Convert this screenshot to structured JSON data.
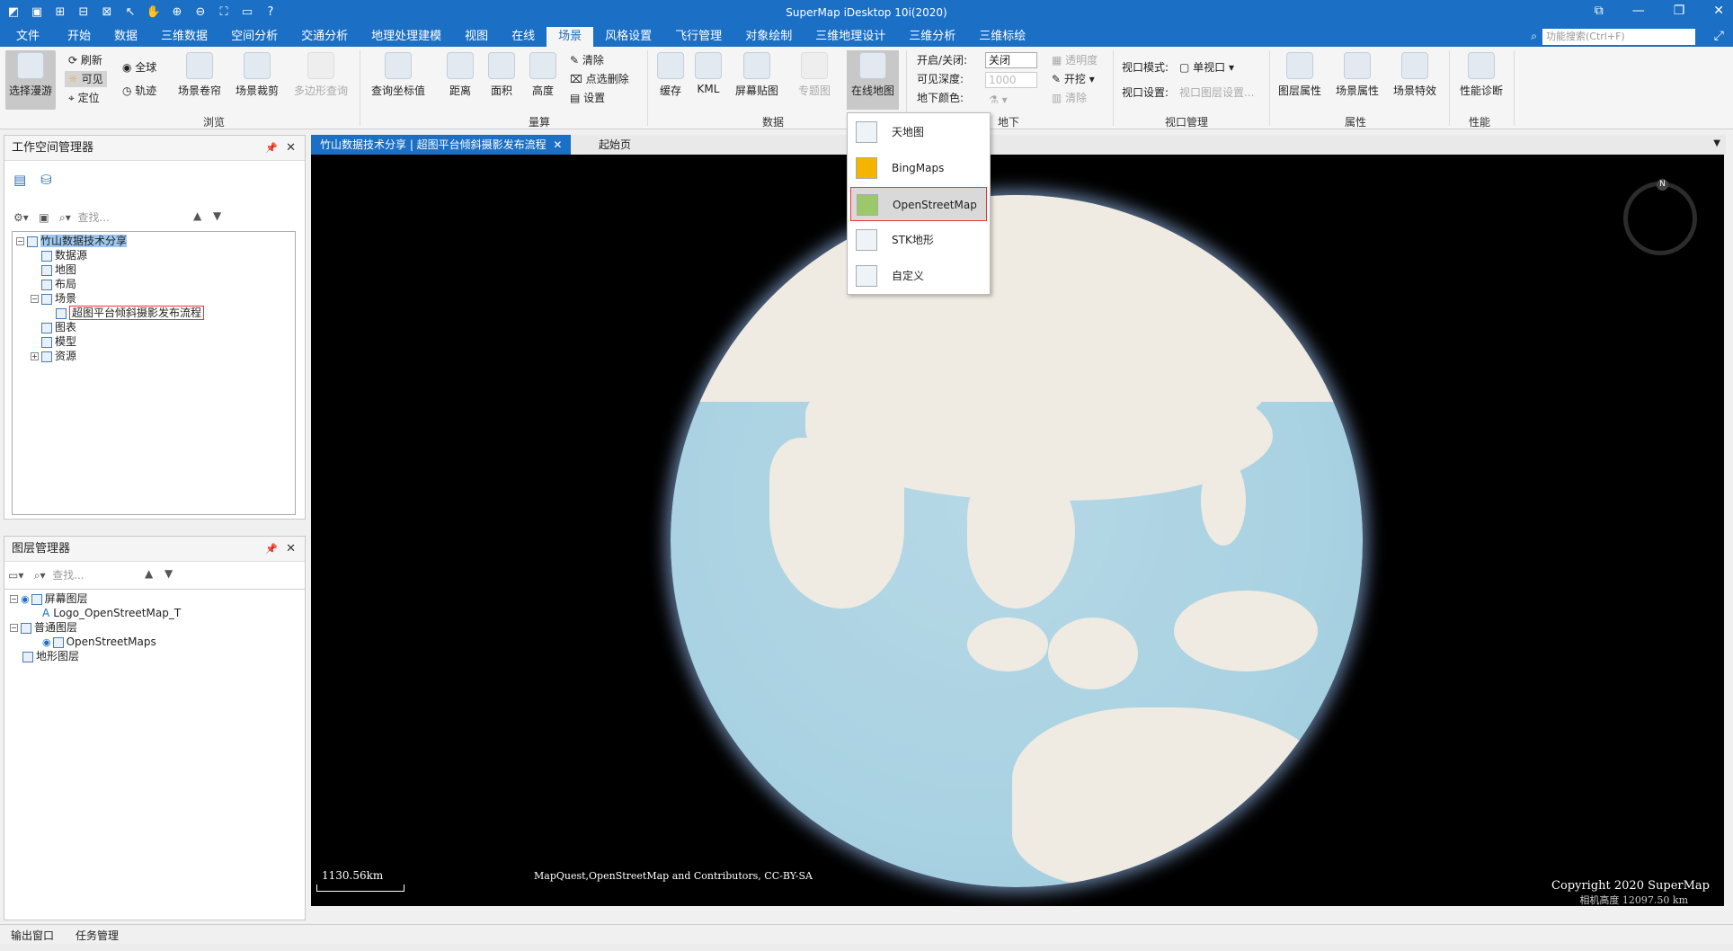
{
  "app": {
    "title": "SuperMap iDesktop 10i(2020)"
  },
  "menu": {
    "tabs": [
      "文件",
      "开始",
      "数据",
      "三维数据",
      "空间分析",
      "交通分析",
      "地理处理建模",
      "视图",
      "在线",
      "场景",
      "风格设置",
      "飞行管理",
      "对象绘制",
      "三维地理设计",
      "三维分析",
      "三维标绘"
    ],
    "active": "场景",
    "search_placeholder": "功能搜索(Ctrl+F)"
  },
  "ribbon": {
    "browse": {
      "select_roam": "选择漫游",
      "refresh": "刷新",
      "visible": "可见",
      "locate": "定位",
      "globe": "全球",
      "track": "轨迹",
      "scene_scroll": "场景卷帘",
      "scene_clip": "场景裁剪",
      "polygon_query": "多边形查询",
      "group": "浏览"
    },
    "measure": {
      "query_coord": "查询坐标值",
      "distance": "距离",
      "area": "面积",
      "height": "高度",
      "clear": "清除",
      "point_delete": "点选删除",
      "settings": "设置",
      "group": "量算"
    },
    "data": {
      "cache": "缓存",
      "kml": "KML",
      "screen_patch": "屏幕贴图",
      "thematic": "专题图",
      "online_map": "在线地图",
      "group": "数据"
    },
    "underground": {
      "toggle_label": "开启/关闭:",
      "toggle_value": "关闭",
      "depth_label": "可见深度:",
      "depth_value": "1000",
      "color_label": "地下颜色:",
      "transparency": "透明度",
      "excavate": "开挖",
      "clear": "清除",
      "group": "地下"
    },
    "viewport": {
      "mode_label": "视口模式:",
      "mode_value": "单视口",
      "settings_label": "视口设置:",
      "layer_settings": "视口图层设置...",
      "group": "视口管理"
    },
    "properties": {
      "layer_props": "图层属性",
      "scene_props": "场景属性",
      "scene_effects": "场景特效",
      "group": "属性"
    },
    "performance": {
      "diagnosis": "性能诊断",
      "group": "性能"
    }
  },
  "online_map_menu": {
    "items": [
      "天地图",
      "BingMaps",
      "OpenStreetMap",
      "STK地形",
      "自定义"
    ],
    "selected": "OpenStreetMap"
  },
  "workspace": {
    "title": "工作空间管理器",
    "search_placeholder": "查找...",
    "root": "竹山数据技术分享",
    "children": [
      "数据源",
      "地图",
      "布局",
      "场景",
      "超图平台倾斜摄影发布流程",
      "图表",
      "模型",
      "资源"
    ]
  },
  "layers": {
    "title": "图层管理器",
    "search_placeholder": "查找...",
    "nodes": [
      "屏幕图层",
      "Logo_OpenStreetMap_T",
      "普通图层",
      "OpenStreetMaps",
      "地形图层"
    ]
  },
  "document_tabs": [
    "竹山数据技术分享 | 超图平台倾斜摄影发布流程",
    "起始页"
  ],
  "viewport": {
    "scale_text": "1130.56km",
    "attribution": "MapQuest,OpenStreetMap and Contributors, CC-BY-SA",
    "copyright": "Copyright 2020 SuperMap",
    "camera_height": "相机高度 12097.50 km",
    "compass_north": "N"
  },
  "status": {
    "output": "输出窗口",
    "tasks": "任务管理"
  }
}
